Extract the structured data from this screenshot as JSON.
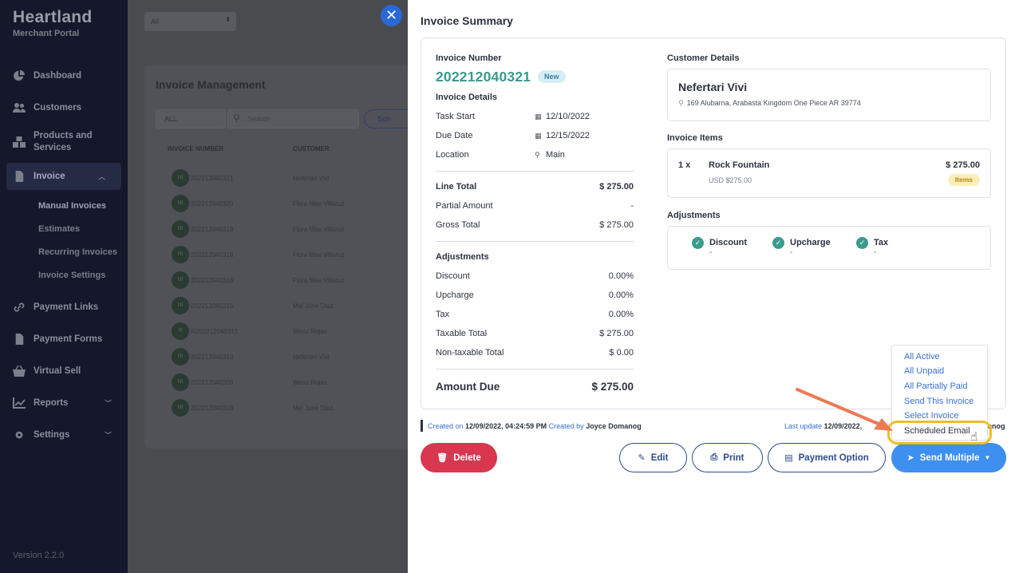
{
  "brand": {
    "name": "Heartland",
    "subtitle": "Merchant Portal",
    "version": "Version 2.2.0"
  },
  "sidebar": {
    "items": [
      {
        "label": "Dashboard",
        "icon": "pie-chart-icon"
      },
      {
        "label": "Customers",
        "icon": "users-icon"
      },
      {
        "label": "Products and Services",
        "icon": "boxes-icon"
      },
      {
        "label": "Invoice",
        "icon": "document-icon",
        "active": true
      },
      {
        "label": "Payment Links",
        "icon": "link-icon"
      },
      {
        "label": "Payment Forms",
        "icon": "form-icon"
      },
      {
        "label": "Virtual Sell",
        "icon": "basket-icon"
      },
      {
        "label": "Reports",
        "icon": "chart-icon"
      },
      {
        "label": "Settings",
        "icon": "gear-icon"
      }
    ],
    "invoice_sub": [
      "Manual Invoices",
      "Estimates",
      "Recurring Invoices",
      "Invoice Settings"
    ]
  },
  "background": {
    "top_select": "All",
    "title": "Invoice Management",
    "filter": "ALL",
    "search_placeholder": "Search",
    "schedule_btn": "Sch",
    "col_invoice": "INVOICE NUMBER",
    "col_customer": "CUSTOMER",
    "rows": [
      {
        "avatar": "NI",
        "number": "202212040321",
        "customer": "Nefertari Vivi"
      },
      {
        "avatar": "NI",
        "number": "202212040320",
        "customer": "Flora Mae Villaruz"
      },
      {
        "avatar": "NI",
        "number": "202212040319",
        "customer": "Flora Mae Villaruz"
      },
      {
        "avatar": "NI",
        "number": "202212040318",
        "customer": "Flora Mae Villaruz"
      },
      {
        "avatar": "NI",
        "number": "202212040316",
        "customer": "Flora Mae Villaruz"
      },
      {
        "avatar": "NI",
        "number": "202212040315",
        "customer": "Mel June Diaz"
      },
      {
        "avatar": "R",
        "number": "R202212040313",
        "customer": "Wenz Rojas"
      },
      {
        "avatar": "NI",
        "number": "202212040310",
        "customer": "Nefertari Vivi"
      },
      {
        "avatar": "NI",
        "number": "202212040309",
        "customer": "Wenz Rojas"
      },
      {
        "avatar": "NI",
        "number": "202212040308",
        "customer": "Mel June Diaz"
      }
    ]
  },
  "panel": {
    "title": "Invoice Summary",
    "invoice_number_label": "Invoice Number",
    "invoice_number": "202212040321",
    "status_badge": "New",
    "details_label": "Invoice Details",
    "task_start_label": "Task Start",
    "task_start": "12/10/2022",
    "due_date_label": "Due Date",
    "due_date": "12/15/2022",
    "location_label": "Location",
    "location": "Main",
    "line_total_label": "Line Total",
    "line_total": "$ 275.00",
    "partial_label": "Partial Amount",
    "partial": "-",
    "gross_label": "Gross Total",
    "gross": "$ 275.00",
    "adjustments_label": "Adjustments",
    "discount_label": "Discount",
    "discount": "0.00%",
    "upcharge_label": "Upcharge",
    "upcharge": "0.00%",
    "tax_label": "Tax",
    "tax": "0.00%",
    "taxable_label": "Taxable Total",
    "taxable": "$ 275.00",
    "nontaxable_label": "Non-taxable Total",
    "nontaxable": "$ 0.00",
    "amount_due_label": "Amount Due",
    "amount_due": "$ 275.00",
    "customer_label": "Customer Details",
    "customer_name": "Nefertari Vivi",
    "customer_address": "169 Alubarna, Arabasta Kingdom One Piece AR 39774",
    "items_label": "Invoice Items",
    "item_qty": "1 x",
    "item_name": "Rock Fountain",
    "item_sub": "USD $275.00",
    "item_price": "$ 275.00",
    "item_badge": "Items",
    "adj_right_label": "Adjustments",
    "adj_right": [
      {
        "name": "Discount",
        "value": "-"
      },
      {
        "name": "Upcharge",
        "value": "-"
      },
      {
        "name": "Tax",
        "value": "-"
      }
    ],
    "created_prefix": "Created on",
    "created_date": "12/09/2022, 04:24:59 PM",
    "created_by_prefix": "Created by",
    "created_by": "Joyce Domanog",
    "updated_prefix": "Last update",
    "updated_date": "12/09/2022,",
    "updated_tail": "anog"
  },
  "menu": [
    "All Active",
    "All Unpaid",
    "All Partially Paid",
    "Send This Invoice",
    "Select Invoice",
    "Scheduled Email"
  ],
  "buttons": {
    "delete": "Delete",
    "edit": "Edit",
    "print": "Print",
    "payment": "Payment Option",
    "send": "Send Multiple"
  },
  "colors": {
    "teal": "#3a9a8e",
    "primary": "#3d8ff0",
    "danger": "#d8374f",
    "navy": "#2f4a8f",
    "highlight": "#efbd25",
    "arrow": "#ec7a53"
  }
}
